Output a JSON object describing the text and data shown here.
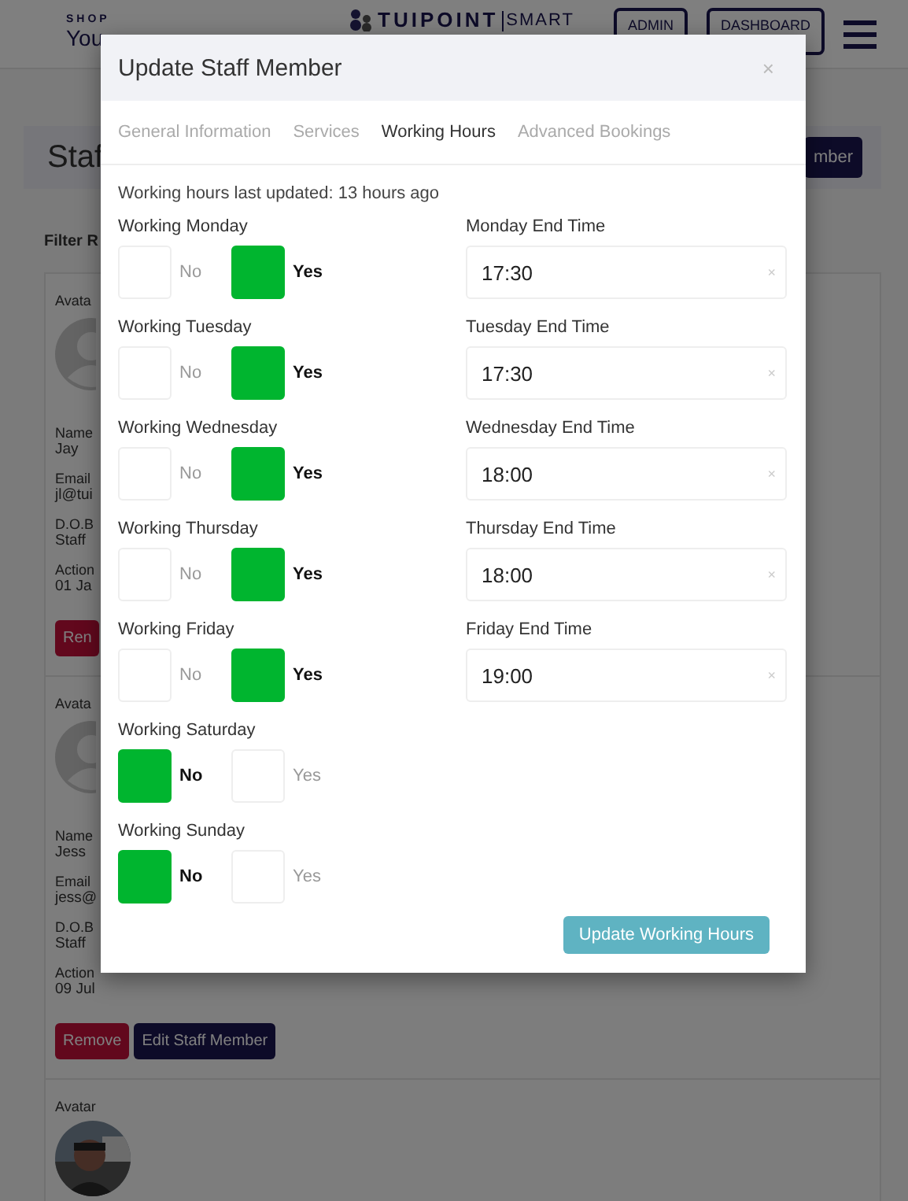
{
  "header": {
    "shop_label": "SHOP",
    "shop_name": "You",
    "logo_left": "TUIPOINT",
    "logo_right": "SMART",
    "buttons": [
      "ADMIN",
      "DASHBOARD"
    ]
  },
  "page": {
    "title": "Staf",
    "add_button": "mber",
    "filter_label": "Filter R"
  },
  "staff_cards": [
    {
      "avatar_label": "Avata",
      "kind": "placeholder",
      "fields": [
        {
          "label": "Name",
          "value": "Jay"
        },
        {
          "label": "Email",
          "value": "jl@tui"
        },
        {
          "label": "D.O.B",
          "value": "Staff"
        },
        {
          "label": "Action",
          "value": "01 Ja"
        }
      ],
      "buttons": [
        "Ren"
      ]
    },
    {
      "avatar_label": "Avata",
      "kind": "placeholder",
      "fields": [
        {
          "label": "Name",
          "value": "Jess"
        },
        {
          "label": "Email",
          "value": "jess@"
        },
        {
          "label": "D.O.B",
          "value": "Staff"
        },
        {
          "label": "Action",
          "value": "09 Jul"
        }
      ],
      "buttons": [
        "Remove",
        "Edit Staff Member"
      ]
    },
    {
      "avatar_label": "Avatar"
    }
  ],
  "modal": {
    "title": "Update Staff Member",
    "close": "×",
    "tabs": [
      {
        "label": "General Information",
        "selected": false
      },
      {
        "label": "Services",
        "selected": false
      },
      {
        "label": "Working Hours",
        "selected": true
      },
      {
        "label": "Advanced Bookings",
        "selected": false
      }
    ],
    "last_updated": "Working hours last updated: 13 hours ago",
    "days": [
      {
        "label": "Working Monday",
        "working": true,
        "no_label": "No",
        "yes_label": "Yes",
        "end_time": {
          "label": "Monday End Time",
          "value": "17:30",
          "clear": "×"
        }
      },
      {
        "label": "Working Tuesday",
        "working": true,
        "no_label": "No",
        "yes_label": "Yes",
        "end_time": {
          "label": "Tuesday End Time",
          "value": "17:30",
          "clear": "×"
        }
      },
      {
        "label": "Working Wednesday",
        "working": true,
        "no_label": "No",
        "yes_label": "Yes",
        "end_time": {
          "label": "Wednesday End Time",
          "value": "18:00",
          "clear": "×"
        }
      },
      {
        "label": "Working Thursday",
        "working": true,
        "no_label": "No",
        "yes_label": "Yes",
        "end_time": {
          "label": "Thursday End Time",
          "value": "18:00",
          "clear": "×"
        }
      },
      {
        "label": "Working Friday",
        "working": true,
        "no_label": "No",
        "yes_label": "Yes",
        "end_time": {
          "label": "Friday End Time",
          "value": "19:00",
          "clear": "×"
        }
      },
      {
        "label": "Working Saturday",
        "working": false,
        "no_label": "No",
        "yes_label": "Yes"
      },
      {
        "label": "Working Sunday",
        "working": false,
        "no_label": "No",
        "yes_label": "Yes"
      }
    ],
    "submit": "Update Working Hours"
  }
}
